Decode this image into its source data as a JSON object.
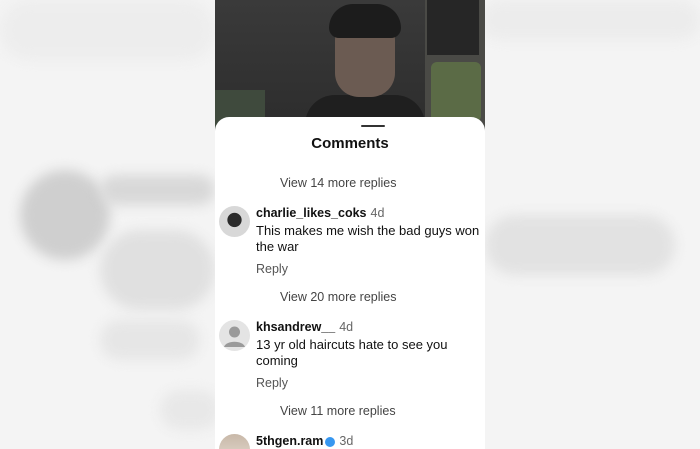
{
  "sheet": {
    "title": "Comments"
  },
  "view_more": [
    "View 14 more replies",
    "View 20 more replies",
    "View 11 more replies"
  ],
  "comments": [
    {
      "username": "charlie_likes_coks",
      "time": "4d",
      "text": "This makes me wish the bad guys won the war",
      "reply_label": "Reply",
      "avatar": "photo-avatar"
    },
    {
      "username": "khsandrew__",
      "time": "4d",
      "text": "13 yr old haircuts hate to see you coming",
      "reply_label": "Reply",
      "avatar": "default-avatar-icon"
    },
    {
      "username": "5thgen.ram",
      "time": "3d",
      "verified": true,
      "avatar": "photo-avatar"
    }
  ],
  "colors": {
    "text": "#111111",
    "secondary": "#555555",
    "verified": "#3797f0"
  }
}
